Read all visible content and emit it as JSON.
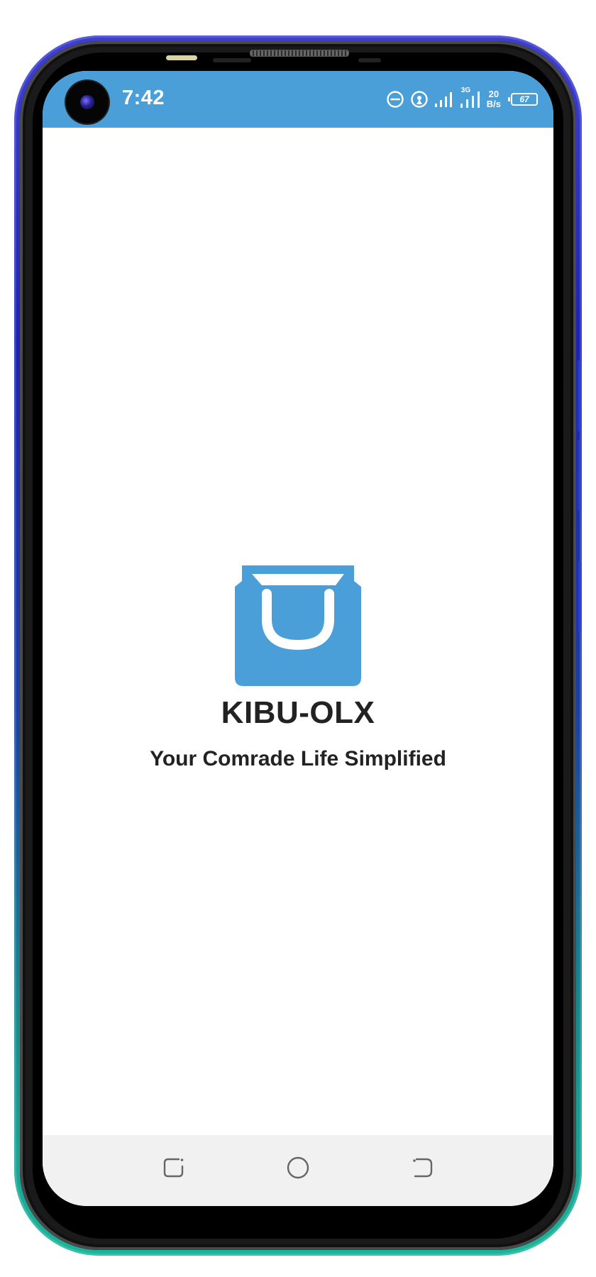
{
  "status_bar": {
    "time": "7:42",
    "network_label": "3G",
    "net_speed_value": "20",
    "net_speed_unit": "B/s",
    "battery_level": "67",
    "color": "#4a9fd8",
    "icons": [
      "do-not-disturb-icon",
      "hotspot-icon",
      "signal-icon",
      "signal-3g-icon",
      "battery-icon"
    ]
  },
  "splash": {
    "app_name": "KIBU-OLX",
    "tagline": "Your Comrade Life Simplified",
    "logo_icon": "shopping-bag-icon",
    "accent_color": "#4a9fd8",
    "text_color": "#222222"
  },
  "nav_bar": {
    "buttons": [
      "menu-icon",
      "home-icon",
      "back-icon"
    ]
  }
}
